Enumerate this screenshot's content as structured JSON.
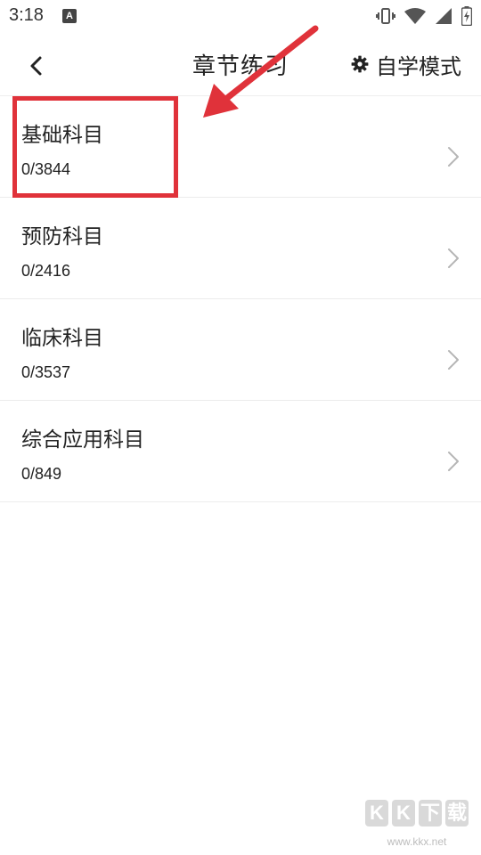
{
  "status_bar": {
    "time": "3:18",
    "notification_icon": "a-letter-icon",
    "icons": [
      "vibrate-icon",
      "wifi-icon",
      "signal-icon",
      "battery-icon"
    ]
  },
  "header": {
    "title": "章节练习",
    "back_icon": "chevron-left-icon",
    "self_study_label": "自学模式",
    "self_study_icon": "gear-icon"
  },
  "subjects": [
    {
      "name": "基础科目",
      "count": "0/3844"
    },
    {
      "name": "预防科目",
      "count": "0/2416"
    },
    {
      "name": "临床科目",
      "count": "0/3537"
    },
    {
      "name": "综合应用科目",
      "count": "0/849"
    }
  ],
  "annotation": {
    "color": "#e0323a"
  },
  "watermark": {
    "letters": [
      "K",
      "K",
      "下",
      "载"
    ],
    "url": "www.kkx.net"
  }
}
